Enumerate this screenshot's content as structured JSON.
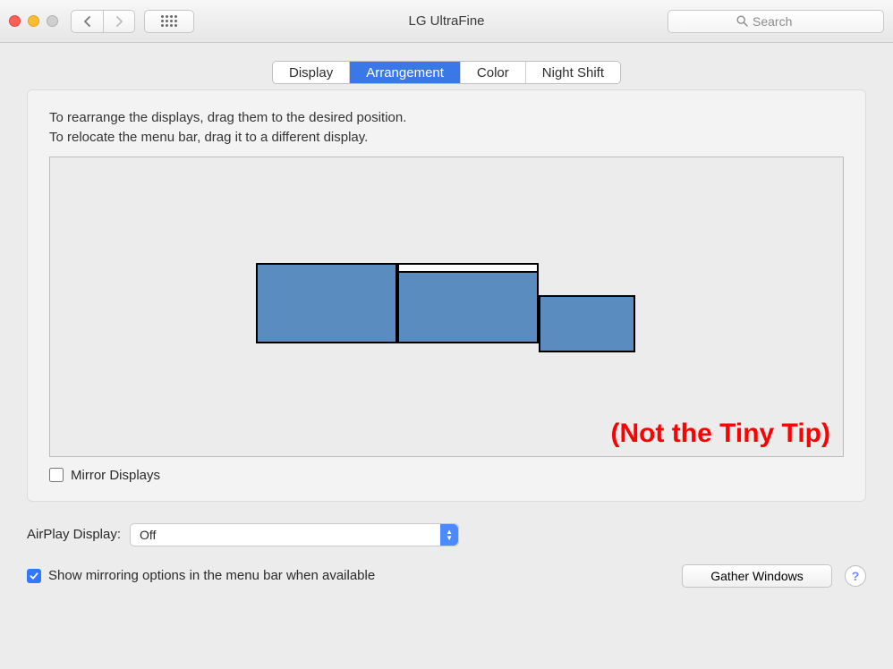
{
  "window": {
    "title": "LG UltraFine",
    "search_placeholder": "Search"
  },
  "tabs": {
    "display": "Display",
    "arrangement": "Arrangement",
    "color": "Color",
    "night_shift": "Night Shift",
    "active": "arrangement"
  },
  "instructions": {
    "line1": "To rearrange the displays, drag them to the desired position.",
    "line2": "To relocate the menu bar, drag it to a different display."
  },
  "overlay_text": "(Not the Tiny Tip)",
  "mirror_label": "Mirror Displays",
  "mirror_checked": false,
  "airplay": {
    "label": "AirPlay Display:",
    "value": "Off"
  },
  "show_mirroring": {
    "label": "Show mirroring options in the menu bar when available",
    "checked": true
  },
  "gather_windows_label": "Gather Windows",
  "help_glyph": "?"
}
